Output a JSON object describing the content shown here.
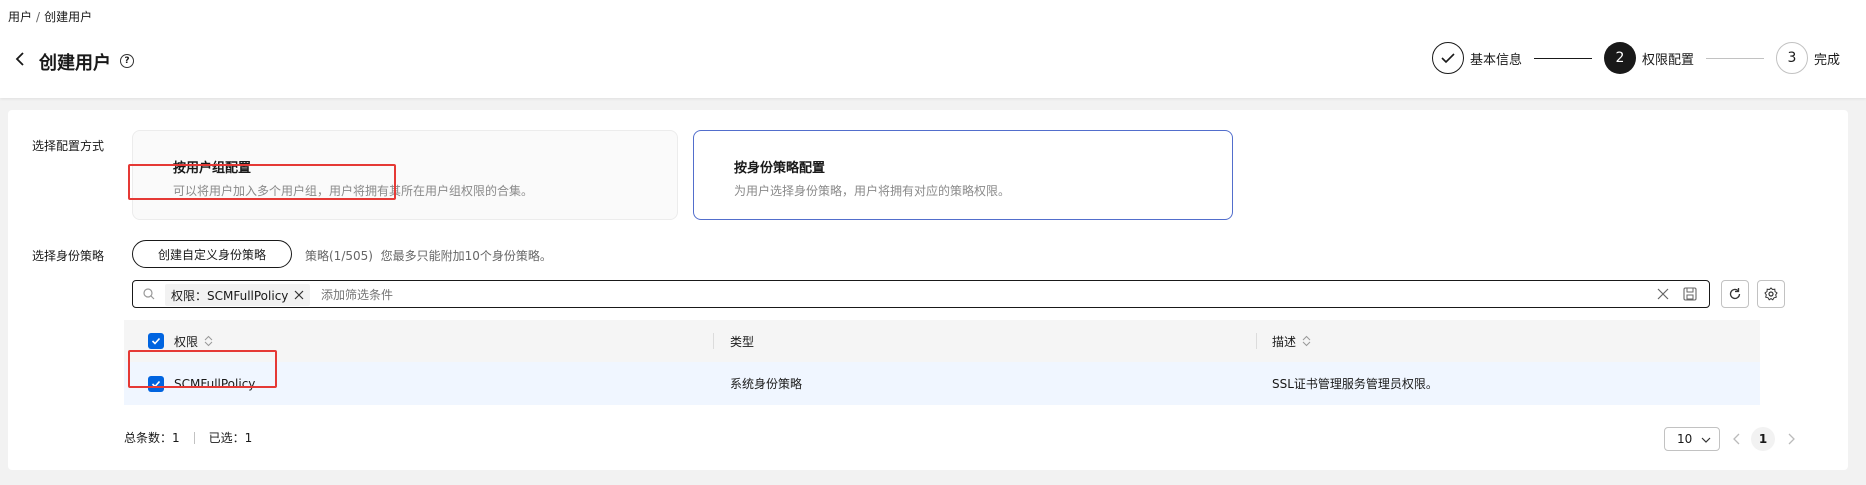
{
  "breadcrumb": {
    "root": "用户",
    "separator": "/",
    "current": "创建用户"
  },
  "header": {
    "title": "创建用户",
    "help": "?"
  },
  "steps": [
    {
      "index": "",
      "label": "基本信息",
      "state": "done"
    },
    {
      "index": "2",
      "label": "权限配置",
      "state": "active"
    },
    {
      "index": "3",
      "label": "完成",
      "state": "todo"
    }
  ],
  "config": {
    "mode_label": "选择配置方式",
    "modes": [
      {
        "title": "按用户组配置",
        "desc": "可以将用户加入多个用户组，用户将拥有其所在用户组权限的合集。",
        "selected": false
      },
      {
        "title": "按身份策略配置",
        "desc": "为用户选择身份策略，用户将拥有对应的策略权限。",
        "selected": true
      }
    ],
    "policy_label": "选择身份策略",
    "create_button": "创建自定义身份策略",
    "policy_count": "策略(1/505)  您最多只能附加10个身份策略。"
  },
  "search": {
    "chip_text": "权限：SCMFullPolicy",
    "placeholder": "添加筛选条件"
  },
  "table": {
    "columns": [
      "权限",
      "类型",
      "描述"
    ],
    "rows": [
      {
        "name": "SCMFullPolicy",
        "type": "系统身份策略",
        "desc": "SSL证书管理服务管理员权限。",
        "checked": true
      }
    ]
  },
  "footer": {
    "total": "总条数：1",
    "selected": "已选：1",
    "page_size": "10",
    "current_page": "1"
  },
  "colors": {
    "accent": "#0064e0",
    "selected_border": "#526ecc",
    "highlight": "#e53935"
  }
}
